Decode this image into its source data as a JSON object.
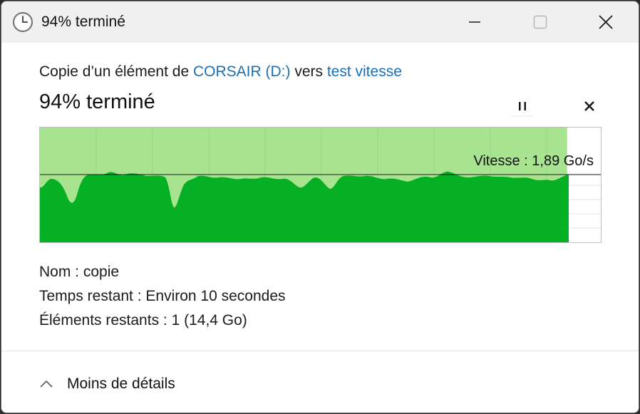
{
  "window": {
    "title": "94% terminé"
  },
  "dialog": {
    "copy_prefix": "Copie d’un élément de ",
    "source": "CORSAIR (D:)",
    "copy_middle": " vers ",
    "destination": "test vitesse",
    "progress_title": "94% terminé",
    "progress_percent": 94,
    "speed": "Vitesse : 1,89 Go/s"
  },
  "details": {
    "name_label": "Nom : ",
    "name_value": "copie",
    "time_label": "Temps restant : ",
    "time_value": "Environ 10 secondes",
    "items_label": "Éléments restants : ",
    "items_value": "1 (14,4 Go)"
  },
  "footer": {
    "toggle_label": "Moins de détails"
  },
  "colors": {
    "accent_link": "#1a6fb5",
    "graph_fill": "#06b025",
    "graph_background_fill": "#a8e490"
  },
  "icons": {
    "title": "clock-icon",
    "pause": "pause-icon",
    "cancel": "close-icon",
    "toggle": "chevron-up-icon"
  }
}
